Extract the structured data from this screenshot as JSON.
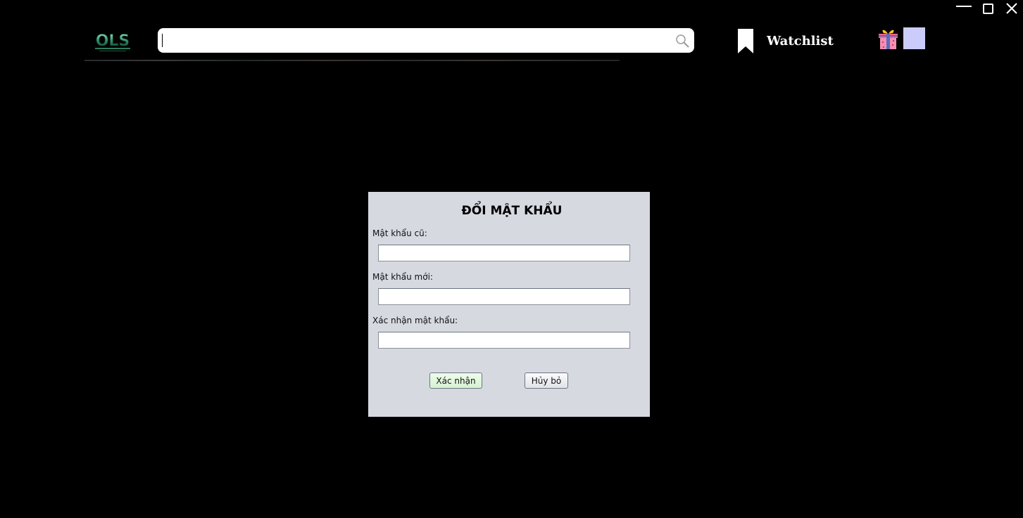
{
  "window": {
    "minimize_icon": "minimize-icon",
    "maximize_icon": "maximize-icon",
    "close_icon": "close-icon"
  },
  "header": {
    "logo_text": "OLS",
    "search": {
      "value": "",
      "placeholder": ""
    },
    "watchlist_label": "Watchlist",
    "icons": [
      "bookmark-icon",
      "search-icon",
      "gift-icon",
      "avatar"
    ],
    "avatar_color": "#ccccfc"
  },
  "dialog": {
    "title": "ĐỔI MẬT KHẨU",
    "fields": [
      {
        "label": "Mật khẩu cũ:",
        "value": ""
      },
      {
        "label": "Mật khẩu mới:",
        "value": ""
      },
      {
        "label": "Xác nhận mật khẩu:",
        "value": ""
      }
    ],
    "confirm_label": "Xác nhận",
    "cancel_label": "Hủy bỏ",
    "background_color": "#d6d9e0",
    "confirm_color": "#d5f2d0"
  }
}
